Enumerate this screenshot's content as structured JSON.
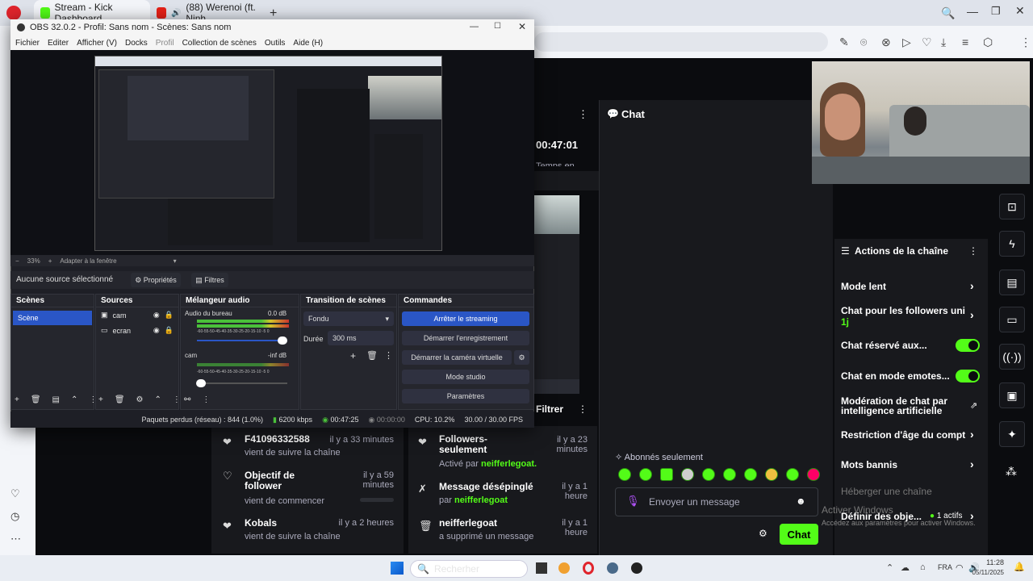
{
  "browser": {
    "tabs": [
      {
        "title": "Stream - Kick Dashboard",
        "active": true
      },
      {
        "title": "(88) Werenoi (ft. Ninh",
        "audio": true
      }
    ],
    "new_tab": "+"
  },
  "stream": {
    "timer": "00:47:01",
    "timer_sub": "Temps en"
  },
  "chat": {
    "title": "Chat",
    "followers_only": "Abonnés seulement",
    "input_placeholder": "Envoyer un message",
    "send_label": "Chat"
  },
  "actions": {
    "title": "Actions de la chaîne",
    "items": [
      {
        "label": "Mode lent",
        "control": "chevron"
      },
      {
        "label": "Chat pour les followers uni",
        "sub": "1j",
        "control": "chevron"
      },
      {
        "label": "Chat réservé aux...",
        "control": "toggle"
      },
      {
        "label": "Chat en mode emotes...",
        "control": "toggle"
      },
      {
        "label": "Modération de chat par intelligence artificielle",
        "control": "external"
      },
      {
        "label": "Restriction d'âge du compt",
        "control": "chevron"
      },
      {
        "label": "Mots bannis",
        "control": "chevron"
      },
      {
        "label": "Héberger une chaîne",
        "control": "none"
      },
      {
        "label": "Définir des obje...",
        "badge": "1 actifs",
        "control": "chevron"
      }
    ]
  },
  "feed": {
    "filter_label": "Filtrer",
    "left": [
      {
        "title": "F41096332588",
        "sub": "vient de suivre la chaîne",
        "time": "il y a 33 minutes",
        "icon": "heart"
      },
      {
        "title": "Objectif de follower",
        "sub": "vient de commencer",
        "time": "il y a 59 minutes",
        "icon": "heart-outline"
      },
      {
        "title": "Kobals",
        "sub": "vient de suivre la chaîne",
        "time": "il y a 2 heures",
        "icon": "heart"
      }
    ],
    "right": [
      {
        "title": "Followers-seulement",
        "sub_prefix": "Activé par",
        "user": "neifferlegoat.",
        "time": "il y a 23 minutes",
        "icon": "heart"
      },
      {
        "title": "Message désépinglé",
        "sub_prefix": "par",
        "user": "neifferlegoat",
        "time": "il y a 1 heure",
        "icon": "unpin"
      },
      {
        "title": "neifferlegoat",
        "sub_prefix": "a supprimé un message",
        "user": "",
        "time": "il y a 1 heure",
        "icon": "trash"
      }
    ]
  },
  "obs": {
    "title": "OBS 32.0.2 - Profil: Sans nom - Scènes: Sans nom",
    "menu": [
      "Fichier",
      "Editer",
      "Afficher (V)",
      "Docks",
      "Profil",
      "Collection de scènes",
      "Outils",
      "Aide (H)"
    ],
    "zoom": "33%",
    "fit": "Adapter à la fenêtre",
    "no_source": "Aucune source sélectionné",
    "properties": "Propriétés",
    "filters": "Filtres",
    "docks": {
      "scenes": {
        "title": "Scènes",
        "items": [
          "Scène"
        ]
      },
      "sources": {
        "title": "Sources",
        "items": [
          "cam",
          "ecran"
        ]
      },
      "mixer": {
        "title": "Mélangeur audio",
        "channels": [
          {
            "name": "Audio du bureau",
            "level": "0.0 dB"
          },
          {
            "name": "cam",
            "level": "-inf dB"
          }
        ],
        "scale": "-60-55-50-45-40-35-30-25-20-15-10 -5 0"
      },
      "transitions": {
        "title": "Transition de scènes",
        "type": "Fondu",
        "duration_label": "Durée",
        "duration": "300 ms"
      },
      "controls": {
        "title": "Commandes",
        "buttons": [
          "Arrêter le streaming",
          "Démarrer l'enregistrement",
          "Démarrer la caméra virtuelle",
          "Mode studio",
          "Paramètres"
        ]
      }
    },
    "status": {
      "dropped": "Paquets perdus (réseau) : 844 (1.0%)",
      "bitrate": "6200 kbps",
      "live": "00:47:25",
      "rec": "00:00:00",
      "cpu": "CPU: 10.2%",
      "fps": "30.00 / 30.00 FPS"
    }
  },
  "watermark": {
    "line1": "Activer Windows",
    "line2": "Accédez aux paramètres pour activer Windows."
  },
  "taskbar": {
    "search": "Recherher",
    "lang": "FRA",
    "time": "11:28",
    "date": "05/11/2025"
  },
  "colors": {
    "kick_green": "#53fc18",
    "obs_blue": "#2a56c6",
    "panel": "#18191d"
  }
}
